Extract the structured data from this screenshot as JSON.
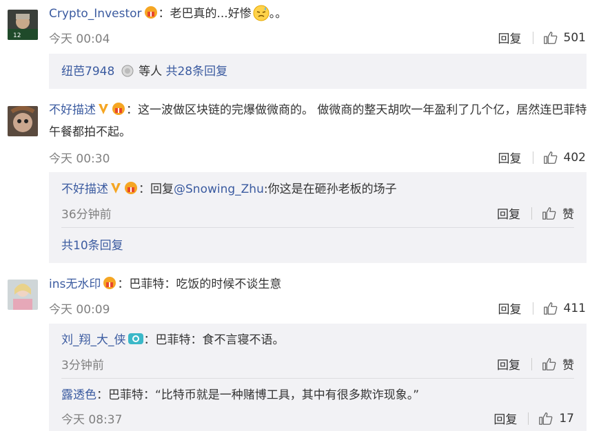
{
  "comments": [
    {
      "user": "Crypto_Investor",
      "text": "：老巴真的...好惨",
      "text_tail": "。。",
      "time": "今天 00:04",
      "reply_label": "回复",
      "likes": "501",
      "thread": {
        "user": "纽芭7948",
        "middle": "等人",
        "link": "共28条回复"
      }
    },
    {
      "user": "不好描述",
      "text": "：这一波做区块链的完爆做微商的。 做微商的整天胡吹一年盈利了几个亿，居然连巴菲特午餐都拍不起。",
      "time": "今天 00:30",
      "reply_label": "回复",
      "likes": "402",
      "replies": [
        {
          "user": "不好描述",
          "text_prefix": "：回复",
          "mention": "@Snowing_Zhu",
          "text": ":你这是在砸孙老板的场子",
          "time": "36分钟前",
          "reply_label": "回复",
          "like_label": "赞"
        }
      ],
      "more": "共10条回复"
    },
    {
      "user": "ins无水印",
      "text": "：巴菲特：吃饭的时候不谈生意",
      "time": "今天 00:09",
      "reply_label": "回复",
      "likes": "411",
      "replies": [
        {
          "user": "刘_翔_大_侠",
          "text": "：巴菲特：食不言寝不语。",
          "time": "3分钟前",
          "reply_label": "回复",
          "like_label": "赞"
        },
        {
          "user": "露透色",
          "text": "：巴菲特：“比特币就是一种赌博工具，其中有很多欺诈现象。”",
          "time": "今天 08:37",
          "reply_label": "回复",
          "likes": "17"
        }
      ]
    }
  ],
  "colors": {
    "link": "#3b5ba0",
    "muted": "#808080",
    "panel": "#f2f2f5",
    "vip": "#f5a623"
  }
}
